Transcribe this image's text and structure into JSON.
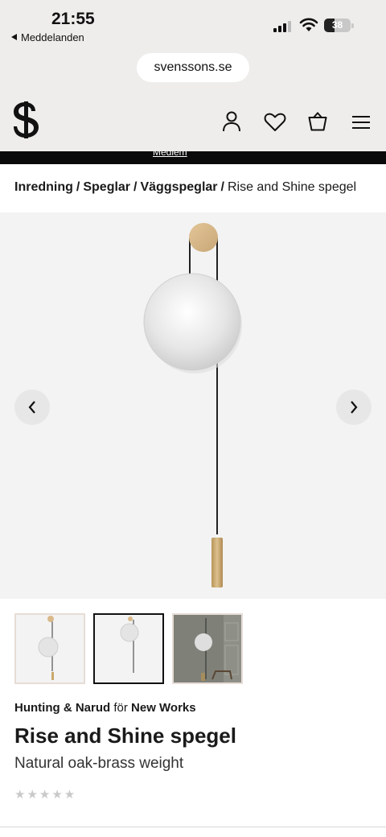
{
  "status": {
    "time": "21:55",
    "back_label": "Meddelanden",
    "battery": "38",
    "battery_fraction": 0.38
  },
  "browser": {
    "url": "svenssons.se"
  },
  "header": {
    "logo": "S",
    "icons": [
      "account-icon",
      "heart-icon",
      "cart-icon",
      "hamburger-menu-icon"
    ],
    "promo_peek": "Medlem"
  },
  "breadcrumb": {
    "items": [
      "Inredning",
      "Speglar",
      "Väggspeglar"
    ],
    "separator": "/",
    "current": "Rise and Shine spegel"
  },
  "gallery": {
    "selected_index": 1,
    "prev_icon": "chevron-left-icon",
    "next_icon": "chevron-right-icon"
  },
  "product": {
    "brand": "Hunting & Narud",
    "for_word": "för",
    "collection": "New Works",
    "title": "Rise and Shine spegel",
    "subtitle": "Natural oak-brass weight",
    "stars": "★★★★★",
    "rating": 0
  },
  "colors": {
    "header_bg": "#efedeb",
    "image_bg": "#f3f3f3",
    "oak": "#d9b98a",
    "brass": "#c9a86a"
  }
}
